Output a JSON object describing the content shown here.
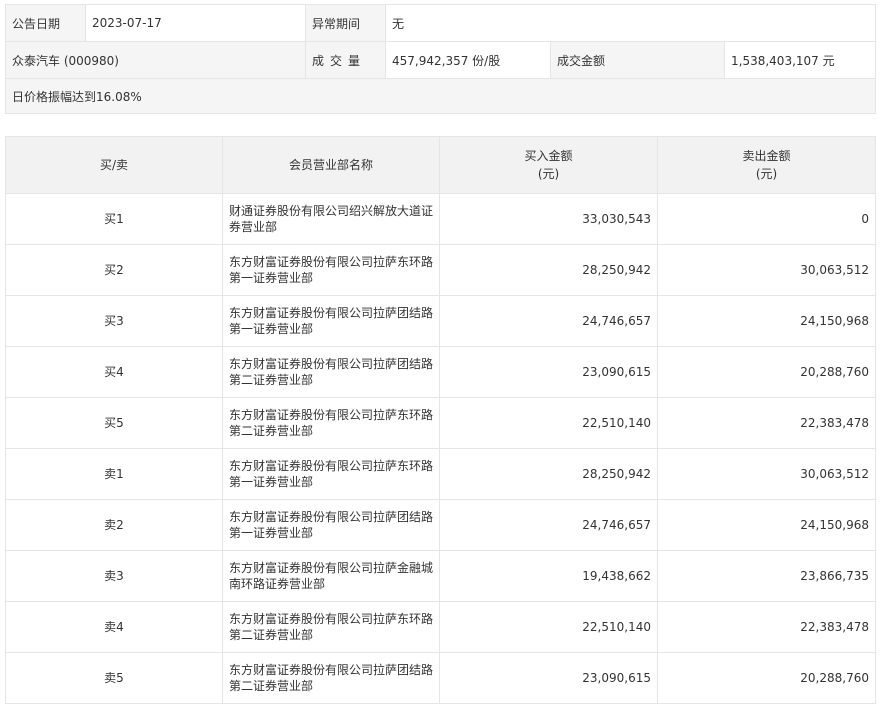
{
  "summary": {
    "date_label": "公告日期",
    "date_value": "2023-07-17",
    "abnormal_label": "异常期间",
    "abnormal_value": "无",
    "stock": "众泰汽车 (000980)",
    "volume_label": "成交量",
    "volume_value": "457,942,357 份/股",
    "amount_label": "成交金额",
    "amount_value": "1,538,403,107 元",
    "reason": "日价格振幅达到16.08%"
  },
  "table": {
    "headers": {
      "side": "买/卖",
      "branch": "会员营业部名称",
      "buy_line1": "买入金额",
      "buy_line2": "(元)",
      "sell_line1": "卖出金额",
      "sell_line2": "(元)"
    },
    "rows": [
      {
        "side": "买1",
        "branch": "财通证券股份有限公司绍兴解放大道证券营业部",
        "buy": "33,030,543",
        "sell": "0"
      },
      {
        "side": "买2",
        "branch": "东方财富证券股份有限公司拉萨东环路第一证券营业部",
        "buy": "28,250,942",
        "sell": "30,063,512"
      },
      {
        "side": "买3",
        "branch": "东方财富证券股份有限公司拉萨团结路第一证券营业部",
        "buy": "24,746,657",
        "sell": "24,150,968"
      },
      {
        "side": "买4",
        "branch": "东方财富证券股份有限公司拉萨团结路第二证券营业部",
        "buy": "23,090,615",
        "sell": "20,288,760"
      },
      {
        "side": "买5",
        "branch": "东方财富证券股份有限公司拉萨东环路第二证券营业部",
        "buy": "22,510,140",
        "sell": "22,383,478"
      },
      {
        "side": "卖1",
        "branch": "东方财富证券股份有限公司拉萨东环路第一证券营业部",
        "buy": "28,250,942",
        "sell": "30,063,512"
      },
      {
        "side": "卖2",
        "branch": "东方财富证券股份有限公司拉萨团结路第一证券营业部",
        "buy": "24,746,657",
        "sell": "24,150,968"
      },
      {
        "side": "卖3",
        "branch": "东方财富证券股份有限公司拉萨金融城南环路证券营业部",
        "buy": "19,438,662",
        "sell": "23,866,735"
      },
      {
        "side": "卖4",
        "branch": "东方财富证券股份有限公司拉萨东环路第二证券营业部",
        "buy": "22,510,140",
        "sell": "22,383,478"
      },
      {
        "side": "卖5",
        "branch": "东方财富证券股份有限公司拉萨团结路第二证券营业部",
        "buy": "23,090,615",
        "sell": "20,288,760"
      }
    ]
  }
}
